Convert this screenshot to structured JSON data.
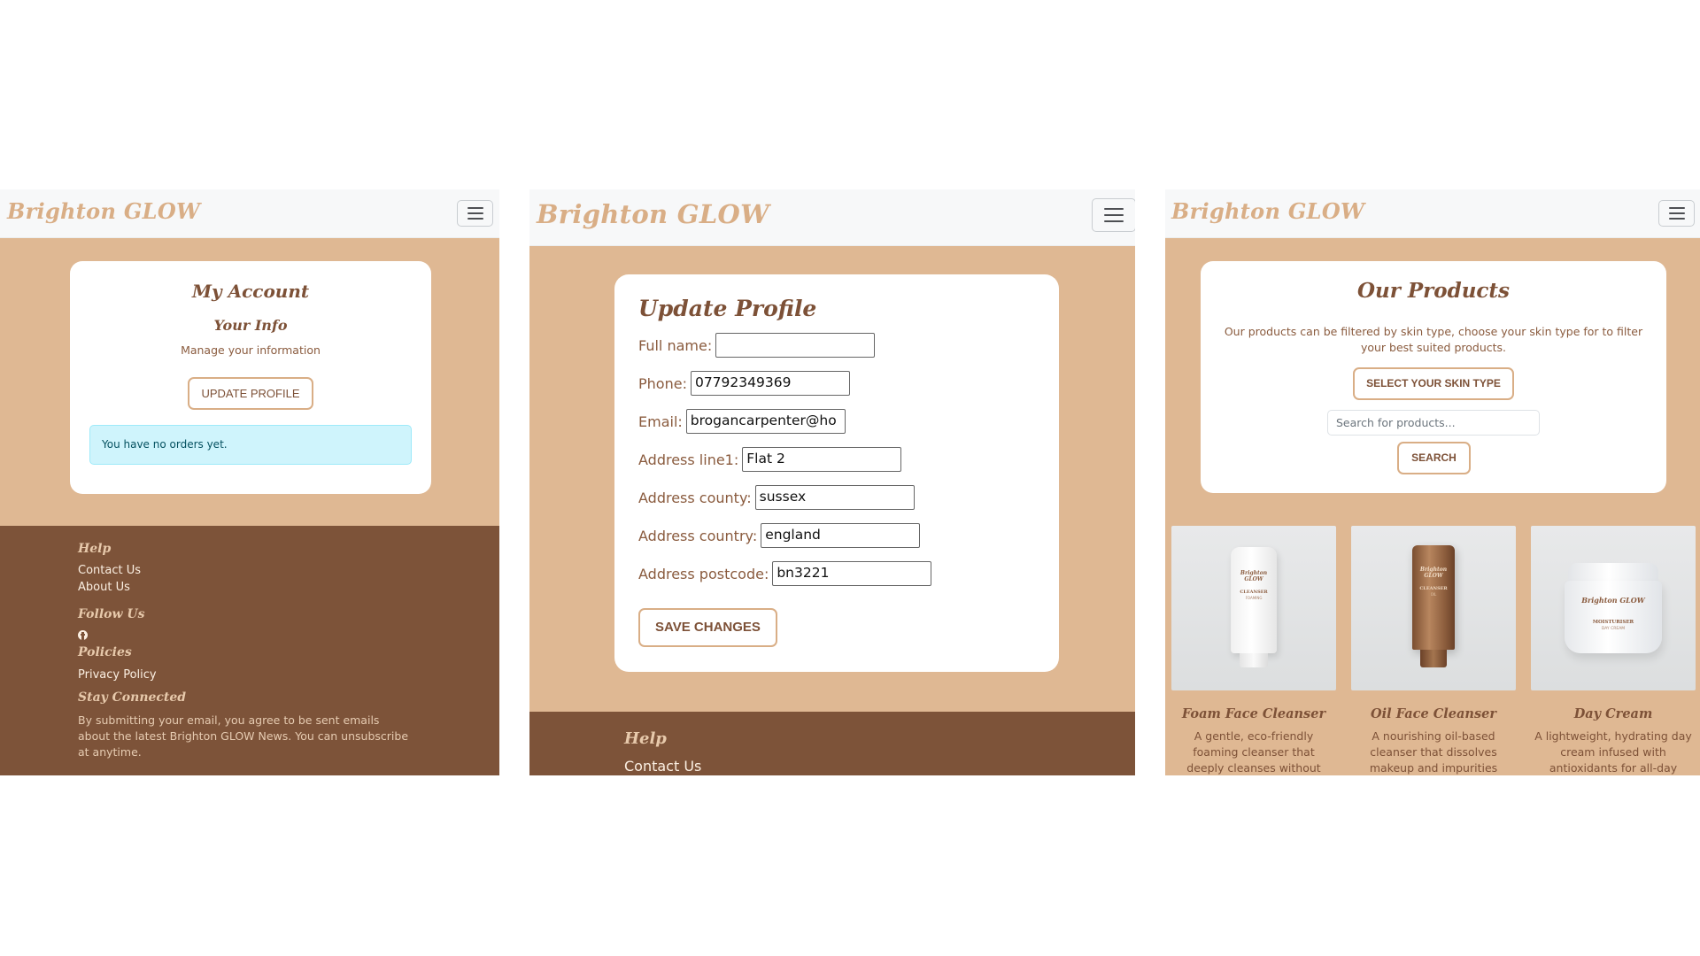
{
  "brand": "Brighton GLOW",
  "colors": {
    "background": "#dfb893",
    "navbar": "#f7f8f9",
    "brand_text": "#d9ae86",
    "footer": "#7d5339",
    "heading": "#7d5137",
    "alert": "#cff4fc"
  },
  "account_page": {
    "title": "My Account",
    "info_heading": "Your Info",
    "info_subtitle": "Manage your information",
    "update_button": "UPDATE PROFILE",
    "orders_alert": "You have no orders yet.",
    "footer": {
      "help_heading": "Help",
      "contact_link": "Contact Us",
      "about_link": "About Us",
      "follow_heading": "Follow Us",
      "policies_heading": "Policies",
      "privacy_link": "Privacy Policy",
      "stay_heading": "Stay Connected",
      "stay_text": "By submitting your email, you agree to be sent emails about the latest Brighton GLOW News. You can unsubscribe at anytime."
    }
  },
  "update_page": {
    "title": "Update Profile",
    "fields": [
      {
        "label": "Full name:",
        "value": ""
      },
      {
        "label": "Phone:",
        "value": "07792349369"
      },
      {
        "label": "Email:",
        "value": "brogancarpenter@ho"
      },
      {
        "label": "Address line1:",
        "value": "Flat 2"
      },
      {
        "label": "Address county:",
        "value": "sussex"
      },
      {
        "label": "Address country:",
        "value": "england"
      },
      {
        "label": "Address postcode:",
        "value": "bn3221"
      }
    ],
    "save_button": "SAVE CHANGES",
    "footer": {
      "help_heading": "Help",
      "contact_link": "Contact Us"
    }
  },
  "products_page": {
    "title": "Our Products",
    "intro": "Our products can be filtered by skin type, choose your skin type for to filter your best suited products.",
    "skin_button": "SELECT YOUR SKIN TYPE",
    "search_placeholder": "Search for products...",
    "search_button": "SEARCH",
    "products": [
      {
        "name": "Foam Face Cleanser",
        "description": "A gentle, eco-friendly foaming cleanser that deeply cleanses without",
        "label_top": "Brighton GLOW",
        "label_bottom": "CLEANSER",
        "label_sub": "FOAMING"
      },
      {
        "name": "Oil Face Cleanser",
        "description": "A nourishing oil-based cleanser that dissolves makeup and impurities",
        "label_top": "Brighton GLOW",
        "label_bottom": "CLEANSER",
        "label_sub": "OIL"
      },
      {
        "name": "Day Cream",
        "description": "A lightweight, hydrating day cream infused with antioxidants for all-day",
        "label_top": "Brighton GLOW",
        "label_bottom": "MOISTURISER",
        "label_sub": "DAY CREAM"
      }
    ]
  }
}
